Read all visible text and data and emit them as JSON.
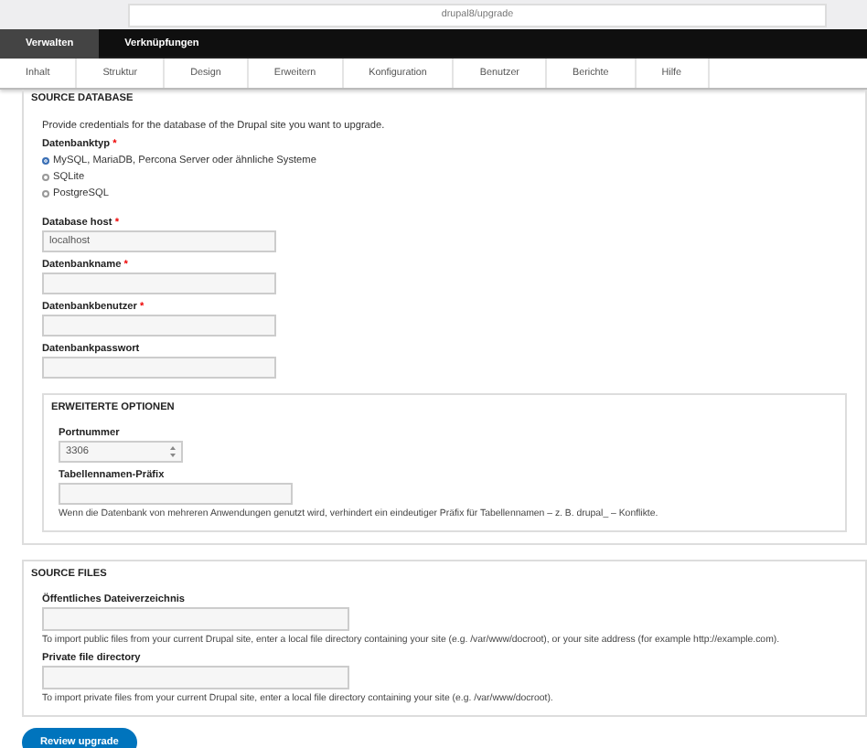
{
  "browser": {
    "url": "drupal8/upgrade"
  },
  "toolbar": {
    "items": [
      {
        "label": "Verwalten",
        "selected": true
      },
      {
        "label": "Verknüpfungen",
        "selected": false
      }
    ]
  },
  "tabs": [
    {
      "label": "Inhalt"
    },
    {
      "label": "Struktur"
    },
    {
      "label": "Design"
    },
    {
      "label": "Erweitern"
    },
    {
      "label": "Konfiguration"
    },
    {
      "label": "Benutzer"
    },
    {
      "label": "Berichte"
    },
    {
      "label": "Hilfe"
    }
  ],
  "source_database": {
    "legend": "SOURCE DATABASE",
    "description": "Provide credentials for the database of the Drupal site you want to upgrade.",
    "db_type": {
      "label": "Datenbanktyp",
      "required_mark": "*",
      "options": [
        {
          "label": "MySQL, MariaDB, Percona Server oder ähnliche Systeme",
          "selected": true
        },
        {
          "label": "SQLite",
          "selected": false
        },
        {
          "label": "PostgreSQL",
          "selected": false
        }
      ]
    },
    "fields": [
      {
        "label": "Database host",
        "required_mark": "*",
        "value": "localhost"
      },
      {
        "label": "Datenbankname",
        "required_mark": "*"
      },
      {
        "label": "Datenbankbenutzer",
        "required_mark": "*"
      },
      {
        "label": "Datenbankpasswort"
      }
    ],
    "advanced": {
      "legend": "ERWEITERTE OPTIONEN",
      "port": {
        "label": "Portnummer",
        "value": "3306"
      },
      "prefix": {
        "label": "Tabellennamen-Präfix",
        "description": "Wenn die Datenbank von mehreren Anwendungen genutzt wird, verhindert ein eindeutiger Präfix für Tabellennamen – z. B. drupal_ – Konflikte."
      }
    }
  },
  "source_files": {
    "legend": "SOURCE FILES",
    "fields": [
      {
        "label": "Öffentliches Dateiverzeichnis",
        "description": "To import public files from your current Drupal site, enter a local file directory containing your site (e.g. /var/www/docroot), or your site address (for example http://example.com)."
      },
      {
        "label": "Private file directory",
        "description": "To import private files from your current Drupal site, enter a local file directory containing your site (e.g. /var/www/docroot)."
      }
    ]
  },
  "submit": {
    "label": "Review upgrade"
  }
}
